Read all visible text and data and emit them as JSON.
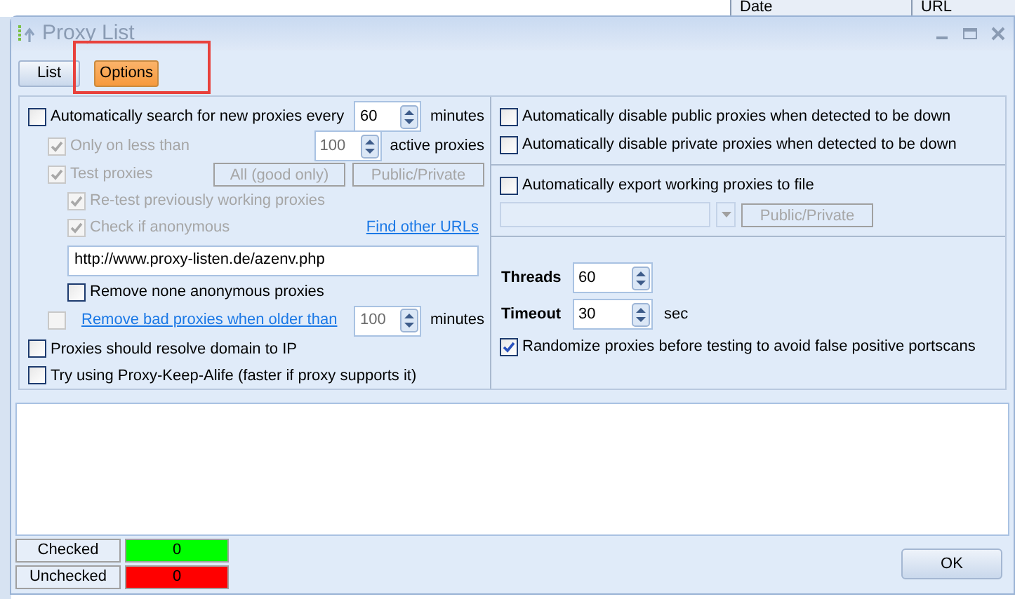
{
  "background_table": {
    "columns": [
      "Date",
      "URL"
    ]
  },
  "window": {
    "title": "Proxy List"
  },
  "tabs": [
    {
      "label": "List",
      "selected": false
    },
    {
      "label": "Options",
      "selected": true
    }
  ],
  "highlight": {
    "shown": true
  },
  "left_options": [
    {
      "kind": "checkbox",
      "label": "Automatically search for new proxies every",
      "checked": false,
      "disabled": false,
      "spin": "60",
      "unit": "minutes",
      "children": [
        {
          "kind": "checkbox",
          "label": "Only on less than",
          "checked": true,
          "disabled": true,
          "spin": "100",
          "unit": "active proxies"
        },
        {
          "kind": "checkbox",
          "label": "Test proxies",
          "checked": true,
          "disabled": true,
          "buttons": [
            {
              "label": "All (good only)",
              "disabled": true
            },
            {
              "label": "Public/Private",
              "disabled": true
            }
          ],
          "children": [
            {
              "kind": "checkbox",
              "label": "Re-test previously working proxies",
              "checked": true,
              "disabled": true
            },
            {
              "kind": "checkbox",
              "label": "Check if anonymous",
              "checked": true,
              "disabled": true,
              "link": "Find other URLs"
            },
            {
              "kind": "field",
              "value": "http://www.proxy-listen.de/azenv.php"
            },
            {
              "kind": "checkbox",
              "label": "Remove none anonymous proxies",
              "checked": false,
              "disabled": false
            }
          ]
        },
        {
          "kind": "link_checkbox",
          "label": "Remove bad proxies when older than",
          "checked": false,
          "disabled": true,
          "spin": "100",
          "unit": "minutes"
        }
      ]
    },
    {
      "kind": "checkbox",
      "label": "Proxies should resolve domain to IP",
      "checked": false,
      "disabled": false
    },
    {
      "kind": "checkbox",
      "label": "Try using Proxy-Keep-Alife (faster if proxy supports it)",
      "checked": false,
      "disabled": false
    }
  ],
  "right_sections": [
    [
      {
        "kind": "checkbox",
        "label": "Automatically disable public proxies when detected to be down",
        "checked": false,
        "disabled": false
      },
      {
        "kind": "checkbox",
        "label": "Automatically disable private proxies when detected to be down",
        "checked": false,
        "disabled": false
      }
    ],
    [
      {
        "kind": "checkbox",
        "label": "Automatically export working proxies to file",
        "checked": false,
        "disabled": false
      },
      {
        "kind": "export",
        "disabled": true,
        "button": "Public/Private"
      }
    ],
    [
      {
        "kind": "number",
        "label": "Threads",
        "value": "60"
      },
      {
        "kind": "number",
        "label": "Timeout",
        "value": "30",
        "unit": "sec"
      },
      {
        "kind": "checkbox",
        "label": "Randomize proxies before testing to avoid false positive portscans",
        "checked": true,
        "disabled": false
      }
    ]
  ],
  "counters": [
    {
      "label": "Checked",
      "value": "0",
      "color": "#00ff00"
    },
    {
      "label": "Unchecked",
      "value": "0",
      "color": "#ff0000"
    }
  ],
  "ok_button": "OK"
}
